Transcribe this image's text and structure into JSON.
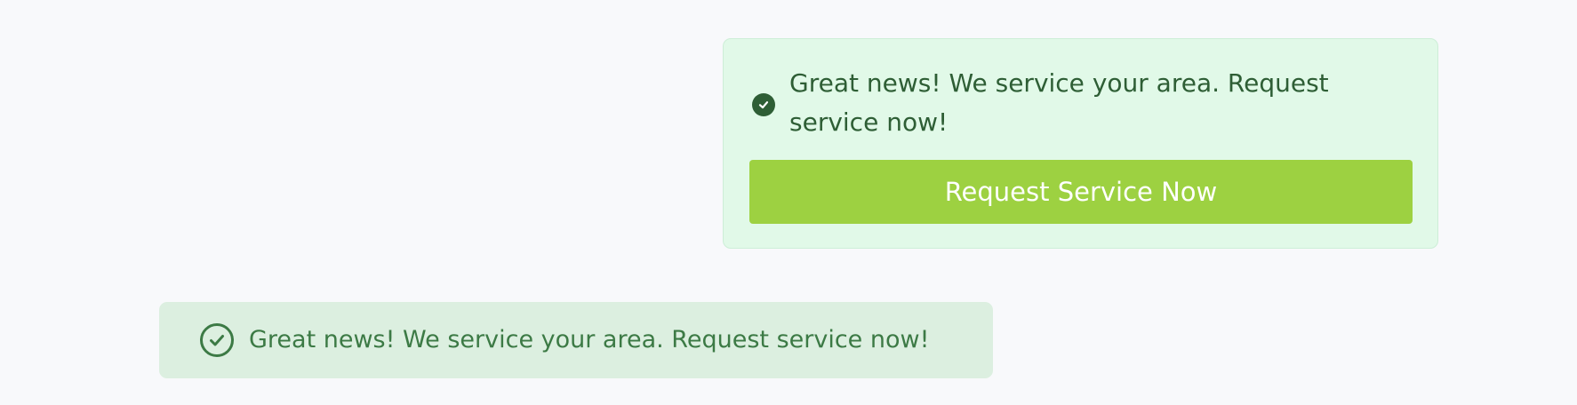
{
  "colors": {
    "page_background": "#f8f9fb",
    "card_background": "#e1f9e8",
    "card_text": "#2e5e35",
    "button_background": "#9dd141",
    "button_text": "#ffffff",
    "banner_background": "#dcefe0",
    "banner_text": "#3c7a45"
  },
  "service_card": {
    "icon": "check-circle-filled-icon",
    "message": "Great news! We service your area. Request service now!",
    "button_label": "Request Service Now"
  },
  "service_banner": {
    "icon": "check-circle-outline-icon",
    "message": "Great news! We service your area. Request service now!"
  }
}
